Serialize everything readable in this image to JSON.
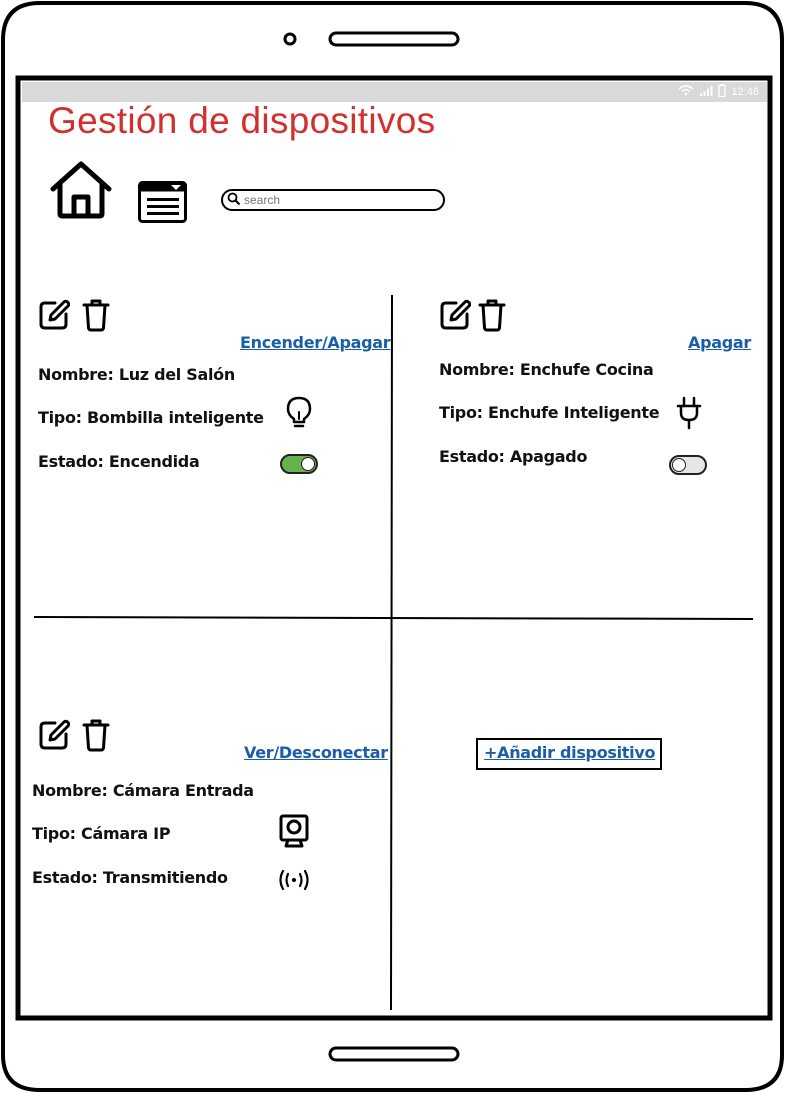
{
  "status_bar": {
    "time": "12:46"
  },
  "app": {
    "title": "Gestión de dispositivos"
  },
  "toolbar": {
    "home_icon": "home-icon",
    "menu_icon": "list-menu-icon",
    "search_placeholder": "search"
  },
  "devices": [
    {
      "action_label": "Encender/Apagar",
      "nombre": "Nombre: Luz del Salón",
      "tipo": "Tipo: Bombilla inteligente",
      "estado": "Estado: Encendida",
      "type_icon": "lightbulb-icon",
      "state_control": "toggle",
      "state_on": true,
      "toggle_color": "#6ab04c"
    },
    {
      "action_label": "Apagar",
      "nombre": "Nombre: Enchufe Cocina",
      "tipo": "Tipo: Enchufe Inteligente",
      "estado": "Estado: Apagado",
      "type_icon": "plug-icon",
      "state_control": "toggle",
      "state_on": false
    },
    {
      "action_label": "Ver/Desconectar",
      "nombre": "Nombre: Cámara Entrada",
      "tipo": "Tipo: Cámara IP",
      "estado": "Estado: Transmitiendo",
      "type_icon": "webcam-icon",
      "state_icon": "broadcast-icon"
    }
  ],
  "add_device": {
    "label": "+Añadir dispositivo"
  },
  "colors": {
    "title": "#d32f2f",
    "link": "#1a5ea8",
    "statusbar": "#d9d9d9"
  }
}
